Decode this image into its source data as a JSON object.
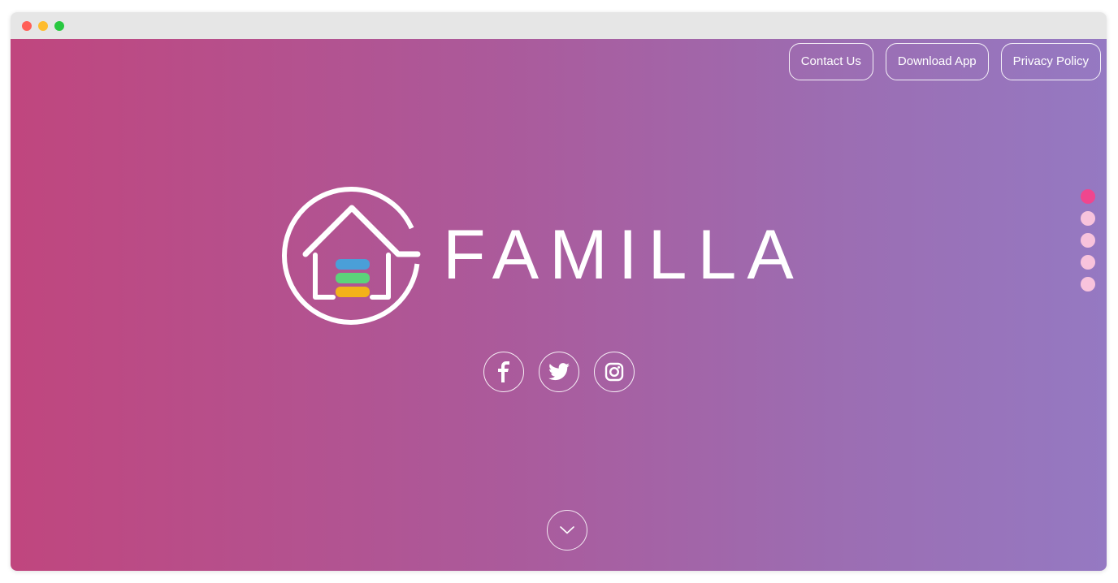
{
  "nav": {
    "contact_label": "Contact Us",
    "download_label": "Download App",
    "privacy_label": "Privacy Policy"
  },
  "brand": {
    "name": "FAMILLA"
  },
  "social": [
    {
      "icon": "facebook-icon"
    },
    {
      "icon": "twitter-icon"
    },
    {
      "icon": "instagram-icon"
    }
  ],
  "page_indicators": {
    "count": 5,
    "active_index": 0,
    "active_color": "#f0468e",
    "inactive_color": "#f8c3dc"
  },
  "colors": {
    "gradient_left": "#c0467e",
    "gradient_right": "#9579c2",
    "logo_bar_blue": "#4a9fd8",
    "logo_bar_green": "#5cd37a",
    "logo_bar_yellow": "#f3b21a"
  },
  "scroll": {
    "icon": "chevron-down-icon"
  }
}
